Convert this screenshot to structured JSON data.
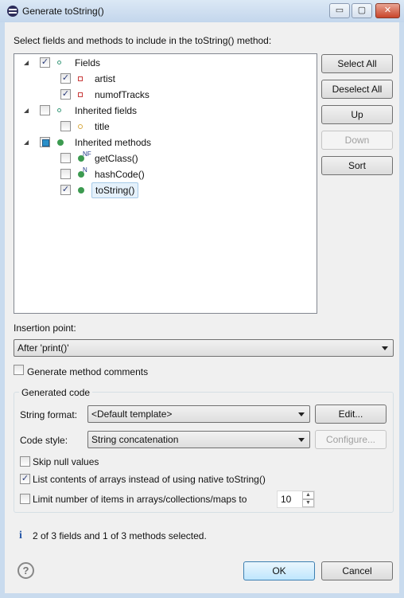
{
  "window": {
    "title": "Generate toString()",
    "minimize": "▭",
    "maximize": "▢",
    "close": "✕"
  },
  "instruction": "Select fields and methods to include in the toString() method:",
  "tree": [
    {
      "label": "Fields",
      "level": 0,
      "state": "checked",
      "icon": "field-group-icon",
      "expanded": true
    },
    {
      "label": "artist",
      "level": 1,
      "state": "checked",
      "icon": "private-field-icon"
    },
    {
      "label": "numofTracks",
      "level": 1,
      "state": "checked",
      "icon": "private-field-icon"
    },
    {
      "label": "Inherited fields",
      "level": 0,
      "state": "unchecked",
      "icon": "field-group-icon",
      "expanded": true
    },
    {
      "label": "title",
      "level": 1,
      "state": "unchecked",
      "icon": "protected-field-icon"
    },
    {
      "label": "Inherited methods",
      "level": 0,
      "state": "partial",
      "icon": "method-group-icon",
      "expanded": true
    },
    {
      "label": "getClass()",
      "level": 1,
      "state": "unchecked",
      "icon": "public-method-icon",
      "overlay": "NF"
    },
    {
      "label": "hashCode()",
      "level": 1,
      "state": "unchecked",
      "icon": "public-method-icon",
      "overlay": "N"
    },
    {
      "label": "toString()",
      "level": 1,
      "state": "checked",
      "icon": "public-method-icon",
      "selected": true
    }
  ],
  "side_buttons": {
    "select_all": "Select All",
    "deselect_all": "Deselect All",
    "up": "Up",
    "down": "Down",
    "sort": "Sort"
  },
  "insertion": {
    "label": "Insertion point:",
    "value": "After 'print()'"
  },
  "method_comments": {
    "label": "Generate method comments",
    "checked": false
  },
  "generated_code": {
    "title": "Generated code",
    "string_format_label": "String format:",
    "string_format_value": "<Default template>",
    "edit": "Edit...",
    "code_style_label": "Code style:",
    "code_style_value": "String concatenation",
    "configure": "Configure...",
    "skip_null": "Skip null values",
    "list_arrays": "List contents of arrays instead of using native toString()",
    "limit_items": "Limit number of items in arrays/collections/maps to",
    "limit_value": "10"
  },
  "status": "2 of 3 fields and 1 of 3 methods selected.",
  "footer": {
    "ok": "OK",
    "cancel": "Cancel",
    "help": "?"
  }
}
